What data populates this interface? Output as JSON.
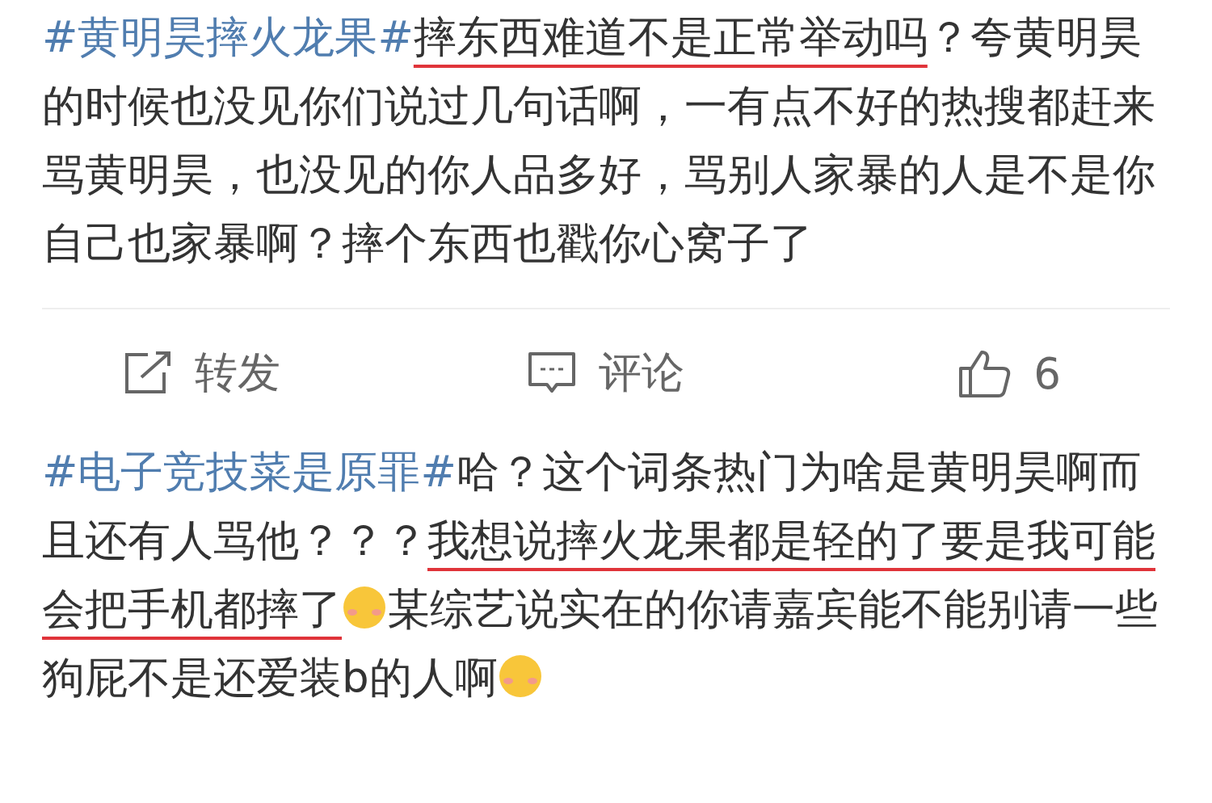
{
  "posts": [
    {
      "segments": [
        {
          "kind": "hashtag",
          "text": "#黄明昊摔火龙果#"
        },
        {
          "kind": "underlined",
          "text": "摔东西难道不是正常举动吗"
        },
        {
          "kind": "text",
          "text": "？夸黄明昊的时候也没见你们说过几句话啊，一有点不好的热搜都赶来骂黄明昊，也没见的你人品多好，骂别人家暴的人是不是你自己也家暴啊？摔个东西也戳你心窝子了"
        }
      ],
      "actions": [
        {
          "kind": "repost",
          "label": "转发"
        },
        {
          "kind": "comment",
          "label": "评论"
        },
        {
          "kind": "like",
          "label": "6"
        }
      ]
    },
    {
      "segments": [
        {
          "kind": "hashtag",
          "text": "#电子竞技菜是原罪#"
        },
        {
          "kind": "text",
          "text": "哈？这个词条热门为啥是黄明昊啊而且还有人骂他？？？"
        },
        {
          "kind": "underlined",
          "text": "我想说摔火龙果都是轻的了要是我可能会把手机都摔了"
        },
        {
          "kind": "emoji"
        },
        {
          "kind": "text",
          "text": "某综艺说实在的你请嘉宾能不能别请一些狗屁不是还爱装b的人啊"
        },
        {
          "kind": "emoji"
        }
      ]
    }
  ]
}
